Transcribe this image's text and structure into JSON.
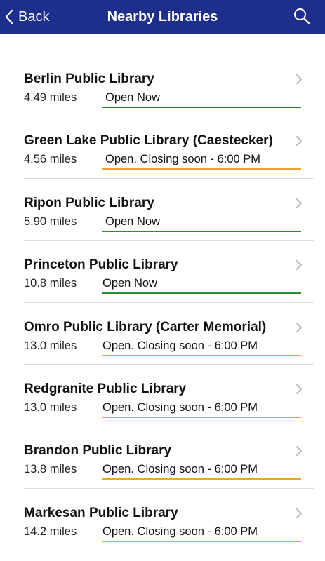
{
  "navbar": {
    "back_label": "Back",
    "title": "Nearby Libraries",
    "search_icon": "search-icon",
    "back_icon": "chevron-left-icon"
  },
  "colors": {
    "navbar_bg": "#1e2e8c",
    "open_now": "#2e8b2e",
    "closing_soon": "#f2a321"
  },
  "libraries": [
    {
      "name": "Berlin Public Library",
      "distance": "4.49 miles",
      "status": "Open Now",
      "status_type": "open"
    },
    {
      "name": "Green Lake Public Library (Caestecker)",
      "distance": "4.56 miles",
      "status": "Open. Closing soon - 6:00 PM",
      "status_type": "closing"
    },
    {
      "name": "Ripon Public Library",
      "distance": "5.90 miles",
      "status": "Open Now",
      "status_type": "open"
    },
    {
      "name": "Princeton Public Library",
      "distance": "10.8 miles",
      "status": "Open Now",
      "status_type": "open"
    },
    {
      "name": "Omro Public Library (Carter Memorial)",
      "distance": "13.0 miles",
      "status": "Open. Closing soon - 6:00 PM",
      "status_type": "closing"
    },
    {
      "name": "Redgranite Public Library",
      "distance": "13.0 miles",
      "status": "Open. Closing soon - 6:00 PM",
      "status_type": "closing"
    },
    {
      "name": "Brandon Public Library",
      "distance": "13.8 miles",
      "status": "Open. Closing soon - 6:00 PM",
      "status_type": "closing"
    },
    {
      "name": "Markesan Public Library",
      "distance": "14.2 miles",
      "status": "Open. Closing soon - 6:00 PM",
      "status_type": "closing"
    }
  ]
}
